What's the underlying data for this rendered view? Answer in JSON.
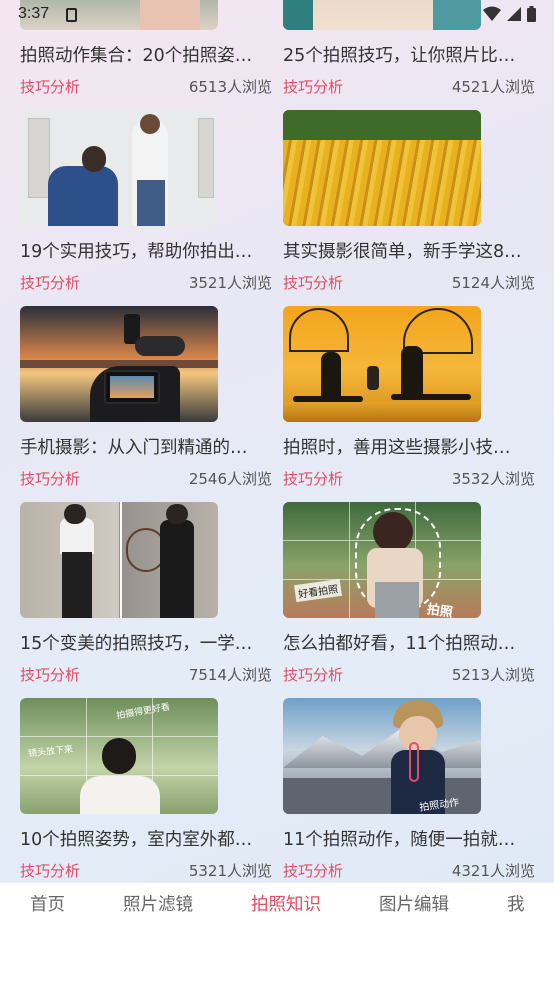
{
  "status": {
    "time": "3:37"
  },
  "cards": [
    {
      "title": "拍照动作集合：20个拍照姿…",
      "tag": "技巧分析",
      "views": "6513人浏览"
    },
    {
      "title": "25个拍照技巧，让你照片比…",
      "tag": "技巧分析",
      "views": "4521人浏览"
    },
    {
      "title": "19个实用技巧，帮助你拍出…",
      "tag": "技巧分析",
      "views": "3521人浏览"
    },
    {
      "title": "其实摄影很简单，新手学这8…",
      "tag": "技巧分析",
      "views": "5124人浏览"
    },
    {
      "title": "手机摄影：从入门到精通的…",
      "tag": "技巧分析",
      "views": "2546人浏览"
    },
    {
      "title": "拍照时，善用这些摄影小技…",
      "tag": "技巧分析",
      "views": "3532人浏览"
    },
    {
      "title": "15个变美的拍照技巧，一学…",
      "tag": "技巧分析",
      "views": "7514人浏览"
    },
    {
      "title": "怎么拍都好看，11个拍照动…",
      "tag": "技巧分析",
      "views": "5213人浏览"
    },
    {
      "title": "10个拍照姿势，室内室外都…",
      "tag": "技巧分析",
      "views": "5321人浏览"
    },
    {
      "title": "11个拍照动作，随便一拍就…",
      "tag": "技巧分析",
      "views": "4321人浏览"
    }
  ],
  "nav": {
    "items": [
      "首页",
      "照片滤镜",
      "拍照知识",
      "图片编辑",
      "我"
    ],
    "active_index": 2
  },
  "thumb_texts": {
    "t8_a": "好看拍照",
    "t8_b": "拍照",
    "t9_a": "拍摄得更好看",
    "t9_b": "镜头放下来",
    "t10": "拍照动作"
  },
  "colors": {
    "accent": "#e24d63",
    "text": "#333333",
    "muted": "#555555"
  }
}
